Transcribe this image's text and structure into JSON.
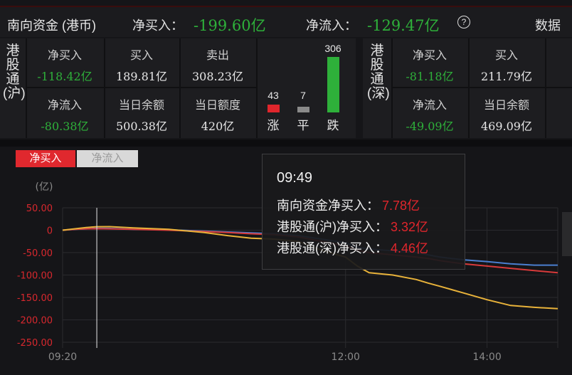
{
  "header": {
    "title": "南向资金 (港币)",
    "net_buy_label": "净买入：",
    "net_buy_value": "-199.60亿",
    "net_inflow_label": "净流入：",
    "net_inflow_value": "-129.47亿",
    "help_icon": "?",
    "more_label": "数据"
  },
  "sh_panel": {
    "title": "港股通(沪)",
    "net_buy_label": "净买入",
    "net_buy_value": "-118.42亿",
    "buy_label": "买入",
    "buy_value": "189.81亿",
    "sell_label": "卖出",
    "sell_value": "308.23亿",
    "net_inflow_label": "净流入",
    "net_inflow_value": "-80.38亿",
    "balance_label": "当日余额",
    "balance_value": "500.38亿",
    "quota_label": "当日额度",
    "quota_value": "420亿",
    "breadth": {
      "up_count": 43,
      "flat_count": 7,
      "down_count": 306,
      "up_label": "涨",
      "flat_label": "平",
      "down_label": "跌",
      "up_color": "#e0262c",
      "flat_color": "#8a8a8a",
      "down_color": "#2eb03a"
    }
  },
  "sz_panel": {
    "title": "港股通(深)",
    "net_buy_label": "净买入",
    "net_buy_value": "-81.18亿",
    "buy_label": "买入",
    "buy_value": "211.79亿",
    "net_inflow_label": "净流入",
    "net_inflow_value": "-49.09亿",
    "balance_label": "当日余额",
    "balance_value": "469.09亿"
  },
  "tabs": {
    "active": "净买入",
    "inactive": "净流入"
  },
  "tooltip": {
    "time": "09:49",
    "rows": [
      {
        "label": "南向资金净买入：",
        "value": "7.78亿"
      },
      {
        "label": "港股通(沪)净买入：",
        "value": "3.32亿"
      },
      {
        "label": "港股通(深)净买入：",
        "value": "4.46亿"
      }
    ]
  },
  "chart_data": {
    "type": "line",
    "ylabel": "(亿)",
    "ylim": [
      -250,
      50
    ],
    "yticks": [
      "50.00",
      "0",
      "-50.00",
      "-100.00",
      "-150.00",
      "-200.00",
      "-250.00"
    ],
    "xticks": [
      "09:20",
      "12:00",
      "14:00"
    ],
    "grid": true,
    "x_minutes": [
      0,
      10,
      20,
      29,
      40,
      60,
      90,
      120,
      140,
      160,
      180,
      200,
      220,
      240,
      250,
      260,
      280,
      300,
      310,
      320,
      340,
      360,
      380,
      400,
      420
    ],
    "cursor_x_minutes": 29,
    "series": [
      {
        "name": "南向资金净买入",
        "color": "#e8b23a",
        "values": [
          0,
          3,
          6,
          7.78,
          8,
          5,
          2,
          -5,
          -12,
          -18,
          -20,
          -25,
          -45,
          -60,
          -80,
          -95,
          -100,
          -110,
          -118,
          -125,
          -140,
          -155,
          -168,
          -172,
          -175
        ]
      },
      {
        "name": "港股通(沪)净买入",
        "color": "#d83a3a",
        "values": [
          0,
          2,
          3,
          3.32,
          3,
          2,
          0,
          -3,
          -5,
          -8,
          -10,
          -15,
          -25,
          -35,
          -45,
          -50,
          -55,
          -60,
          -63,
          -68,
          -75,
          -80,
          -85,
          -90,
          -95
        ]
      },
      {
        "name": "港股通(深)净买入",
        "color": "#4a7fd0",
        "values": [
          0,
          2,
          3,
          4.46,
          4,
          2,
          1,
          -2,
          -4,
          -6,
          -8,
          -12,
          -20,
          -28,
          -38,
          -42,
          -46,
          -50,
          -55,
          -60,
          -66,
          -70,
          -75,
          -78,
          -78
        ]
      }
    ]
  }
}
